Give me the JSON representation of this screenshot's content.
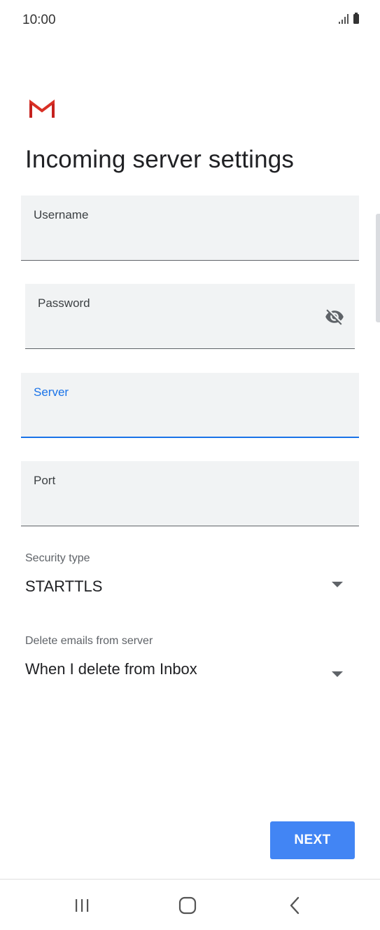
{
  "status_bar": {
    "time": "10:00",
    "icons": [
      "signal-icon",
      "battery-icon"
    ]
  },
  "header": {
    "logo": "gmail-logo",
    "title": "Incoming server settings"
  },
  "fields": {
    "username": {
      "label": "Username",
      "value": ""
    },
    "password": {
      "label": "Password",
      "value": "",
      "toggle_icon": "eye-off-icon"
    },
    "server": {
      "label": "Server",
      "value": "",
      "focused": true
    },
    "port": {
      "label": "Port",
      "value": ""
    }
  },
  "security_type": {
    "label": "Security type",
    "value": "STARTTLS"
  },
  "delete_emails": {
    "label": "Delete emails from server",
    "value": "When I delete from Inbox"
  },
  "actions": {
    "next_label": "NEXT"
  },
  "colors": {
    "accent": "#1a73e8",
    "button": "#4285f4",
    "field_bg": "#f1f3f4",
    "gmail_red": "#d93025"
  },
  "nav_bar": {
    "items": [
      "recents-icon",
      "home-icon",
      "back-icon"
    ]
  }
}
